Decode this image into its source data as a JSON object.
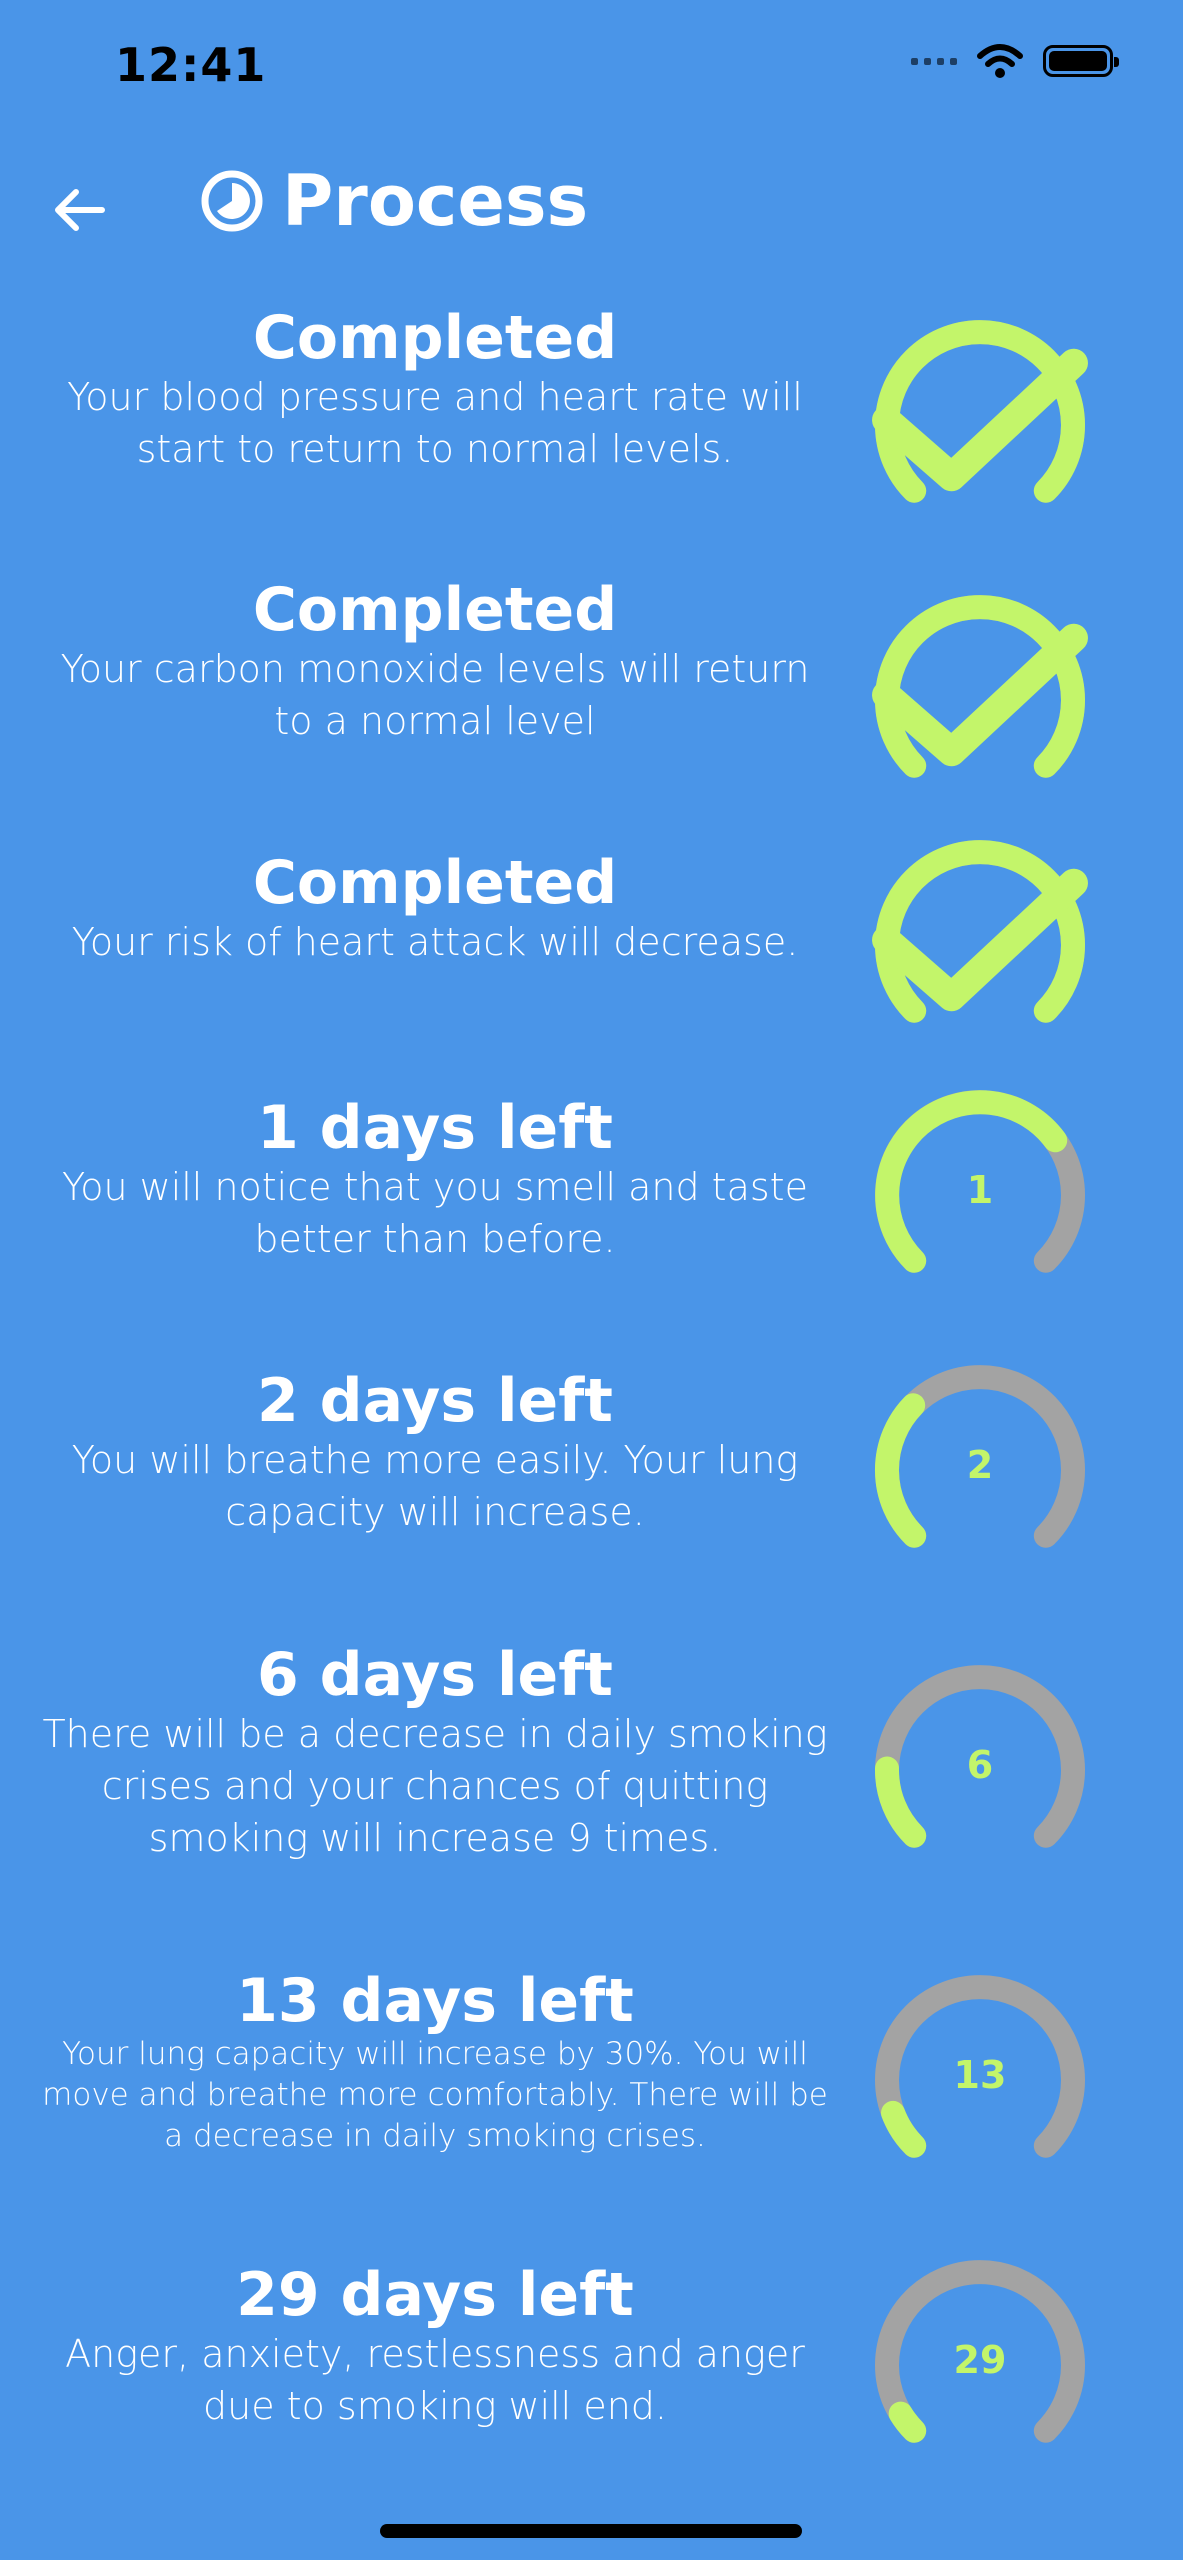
{
  "status_bar": {
    "time": "12:41"
  },
  "header": {
    "title": "Process"
  },
  "colors": {
    "background": "#4a95e8",
    "progress": "#c3f56a",
    "track": "#a3a3a3"
  },
  "items": [
    {
      "title": "Completed",
      "description": "Your blood pressure and heart rate will start to return to normal levels.",
      "status": "completed",
      "center": "",
      "progress": 1.0
    },
    {
      "title": "Completed",
      "description": "Your carbon monoxide levels will return to a normal level",
      "status": "completed",
      "center": "",
      "progress": 1.0
    },
    {
      "title": "Completed",
      "description": "Your risk of heart attack will decrease.",
      "status": "completed",
      "center": "",
      "progress": 1.0
    },
    {
      "title": "1 days left",
      "description": "You will notice that you smell and taste better than before.",
      "status": "pending",
      "center": "1",
      "progress": 0.7
    },
    {
      "title": "2 days left",
      "description": "You will breathe more easily. Your lung capacity will increase.",
      "status": "pending",
      "center": "2",
      "progress": 0.33
    },
    {
      "title": "6 days left",
      "description": "There will be a decrease in daily smoking crises and your chances of quitting smoking will increase 9 times.",
      "status": "pending",
      "center": "6",
      "progress": 0.17
    },
    {
      "title": "13 days left",
      "description": "Your lung capacity will increase by 30%. You will move and breathe more comfortably. There will be a decrease in daily smoking crises.",
      "status": "pending",
      "center": "13",
      "progress": 0.09
    },
    {
      "title": "29 days left",
      "description": "Anger, anxiety, restlessness and anger due to smoking will end.",
      "status": "pending",
      "center": "29",
      "progress": 0.05
    }
  ]
}
